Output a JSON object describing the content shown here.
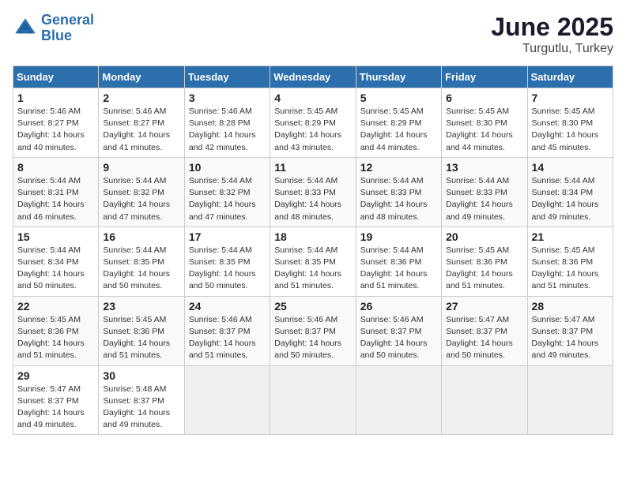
{
  "header": {
    "logo_line1": "General",
    "logo_line2": "Blue",
    "title": "June 2025",
    "subtitle": "Turgutlu, Turkey"
  },
  "calendar": {
    "days_of_week": [
      "Sunday",
      "Monday",
      "Tuesday",
      "Wednesday",
      "Thursday",
      "Friday",
      "Saturday"
    ],
    "weeks": [
      [
        null,
        {
          "day": "2",
          "sunrise": "Sunrise: 5:46 AM",
          "sunset": "Sunset: 8:27 PM",
          "daylight": "Daylight: 14 hours and 41 minutes."
        },
        {
          "day": "3",
          "sunrise": "Sunrise: 5:46 AM",
          "sunset": "Sunset: 8:28 PM",
          "daylight": "Daylight: 14 hours and 42 minutes."
        },
        {
          "day": "4",
          "sunrise": "Sunrise: 5:45 AM",
          "sunset": "Sunset: 8:29 PM",
          "daylight": "Daylight: 14 hours and 43 minutes."
        },
        {
          "day": "5",
          "sunrise": "Sunrise: 5:45 AM",
          "sunset": "Sunset: 8:29 PM",
          "daylight": "Daylight: 14 hours and 44 minutes."
        },
        {
          "day": "6",
          "sunrise": "Sunrise: 5:45 AM",
          "sunset": "Sunset: 8:30 PM",
          "daylight": "Daylight: 14 hours and 44 minutes."
        },
        {
          "day": "7",
          "sunrise": "Sunrise: 5:45 AM",
          "sunset": "Sunset: 8:30 PM",
          "daylight": "Daylight: 14 hours and 45 minutes."
        }
      ],
      [
        {
          "day": "1",
          "sunrise": "Sunrise: 5:46 AM",
          "sunset": "Sunset: 8:27 PM",
          "daylight": "Daylight: 14 hours and 40 minutes."
        },
        {
          "day": "9",
          "sunrise": "Sunrise: 5:44 AM",
          "sunset": "Sunset: 8:32 PM",
          "daylight": "Daylight: 14 hours and 47 minutes."
        },
        {
          "day": "10",
          "sunrise": "Sunrise: 5:44 AM",
          "sunset": "Sunset: 8:32 PM",
          "daylight": "Daylight: 14 hours and 47 minutes."
        },
        {
          "day": "11",
          "sunrise": "Sunrise: 5:44 AM",
          "sunset": "Sunset: 8:33 PM",
          "daylight": "Daylight: 14 hours and 48 minutes."
        },
        {
          "day": "12",
          "sunrise": "Sunrise: 5:44 AM",
          "sunset": "Sunset: 8:33 PM",
          "daylight": "Daylight: 14 hours and 48 minutes."
        },
        {
          "day": "13",
          "sunrise": "Sunrise: 5:44 AM",
          "sunset": "Sunset: 8:33 PM",
          "daylight": "Daylight: 14 hours and 49 minutes."
        },
        {
          "day": "14",
          "sunrise": "Sunrise: 5:44 AM",
          "sunset": "Sunset: 8:34 PM",
          "daylight": "Daylight: 14 hours and 49 minutes."
        }
      ],
      [
        {
          "day": "8",
          "sunrise": "Sunrise: 5:44 AM",
          "sunset": "Sunset: 8:31 PM",
          "daylight": "Daylight: 14 hours and 46 minutes."
        },
        {
          "day": "16",
          "sunrise": "Sunrise: 5:44 AM",
          "sunset": "Sunset: 8:35 PM",
          "daylight": "Daylight: 14 hours and 50 minutes."
        },
        {
          "day": "17",
          "sunrise": "Sunrise: 5:44 AM",
          "sunset": "Sunset: 8:35 PM",
          "daylight": "Daylight: 14 hours and 50 minutes."
        },
        {
          "day": "18",
          "sunrise": "Sunrise: 5:44 AM",
          "sunset": "Sunset: 8:35 PM",
          "daylight": "Daylight: 14 hours and 51 minutes."
        },
        {
          "day": "19",
          "sunrise": "Sunrise: 5:44 AM",
          "sunset": "Sunset: 8:36 PM",
          "daylight": "Daylight: 14 hours and 51 minutes."
        },
        {
          "day": "20",
          "sunrise": "Sunrise: 5:45 AM",
          "sunset": "Sunset: 8:36 PM",
          "daylight": "Daylight: 14 hours and 51 minutes."
        },
        {
          "day": "21",
          "sunrise": "Sunrise: 5:45 AM",
          "sunset": "Sunset: 8:36 PM",
          "daylight": "Daylight: 14 hours and 51 minutes."
        }
      ],
      [
        {
          "day": "15",
          "sunrise": "Sunrise: 5:44 AM",
          "sunset": "Sunset: 8:34 PM",
          "daylight": "Daylight: 14 hours and 50 minutes."
        },
        {
          "day": "23",
          "sunrise": "Sunrise: 5:45 AM",
          "sunset": "Sunset: 8:36 PM",
          "daylight": "Daylight: 14 hours and 51 minutes."
        },
        {
          "day": "24",
          "sunrise": "Sunrise: 5:46 AM",
          "sunset": "Sunset: 8:37 PM",
          "daylight": "Daylight: 14 hours and 51 minutes."
        },
        {
          "day": "25",
          "sunrise": "Sunrise: 5:46 AM",
          "sunset": "Sunset: 8:37 PM",
          "daylight": "Daylight: 14 hours and 50 minutes."
        },
        {
          "day": "26",
          "sunrise": "Sunrise: 5:46 AM",
          "sunset": "Sunset: 8:37 PM",
          "daylight": "Daylight: 14 hours and 50 minutes."
        },
        {
          "day": "27",
          "sunrise": "Sunrise: 5:47 AM",
          "sunset": "Sunset: 8:37 PM",
          "daylight": "Daylight: 14 hours and 50 minutes."
        },
        {
          "day": "28",
          "sunrise": "Sunrise: 5:47 AM",
          "sunset": "Sunset: 8:37 PM",
          "daylight": "Daylight: 14 hours and 49 minutes."
        }
      ],
      [
        {
          "day": "22",
          "sunrise": "Sunrise: 5:45 AM",
          "sunset": "Sunset: 8:36 PM",
          "daylight": "Daylight: 14 hours and 51 minutes."
        },
        {
          "day": "30",
          "sunrise": "Sunrise: 5:48 AM",
          "sunset": "Sunset: 8:37 PM",
          "daylight": "Daylight: 14 hours and 49 minutes."
        },
        null,
        null,
        null,
        null,
        null
      ],
      [
        {
          "day": "29",
          "sunrise": "Sunrise: 5:47 AM",
          "sunset": "Sunset: 8:37 PM",
          "daylight": "Daylight: 14 hours and 49 minutes."
        },
        null,
        null,
        null,
        null,
        null,
        null
      ]
    ]
  }
}
